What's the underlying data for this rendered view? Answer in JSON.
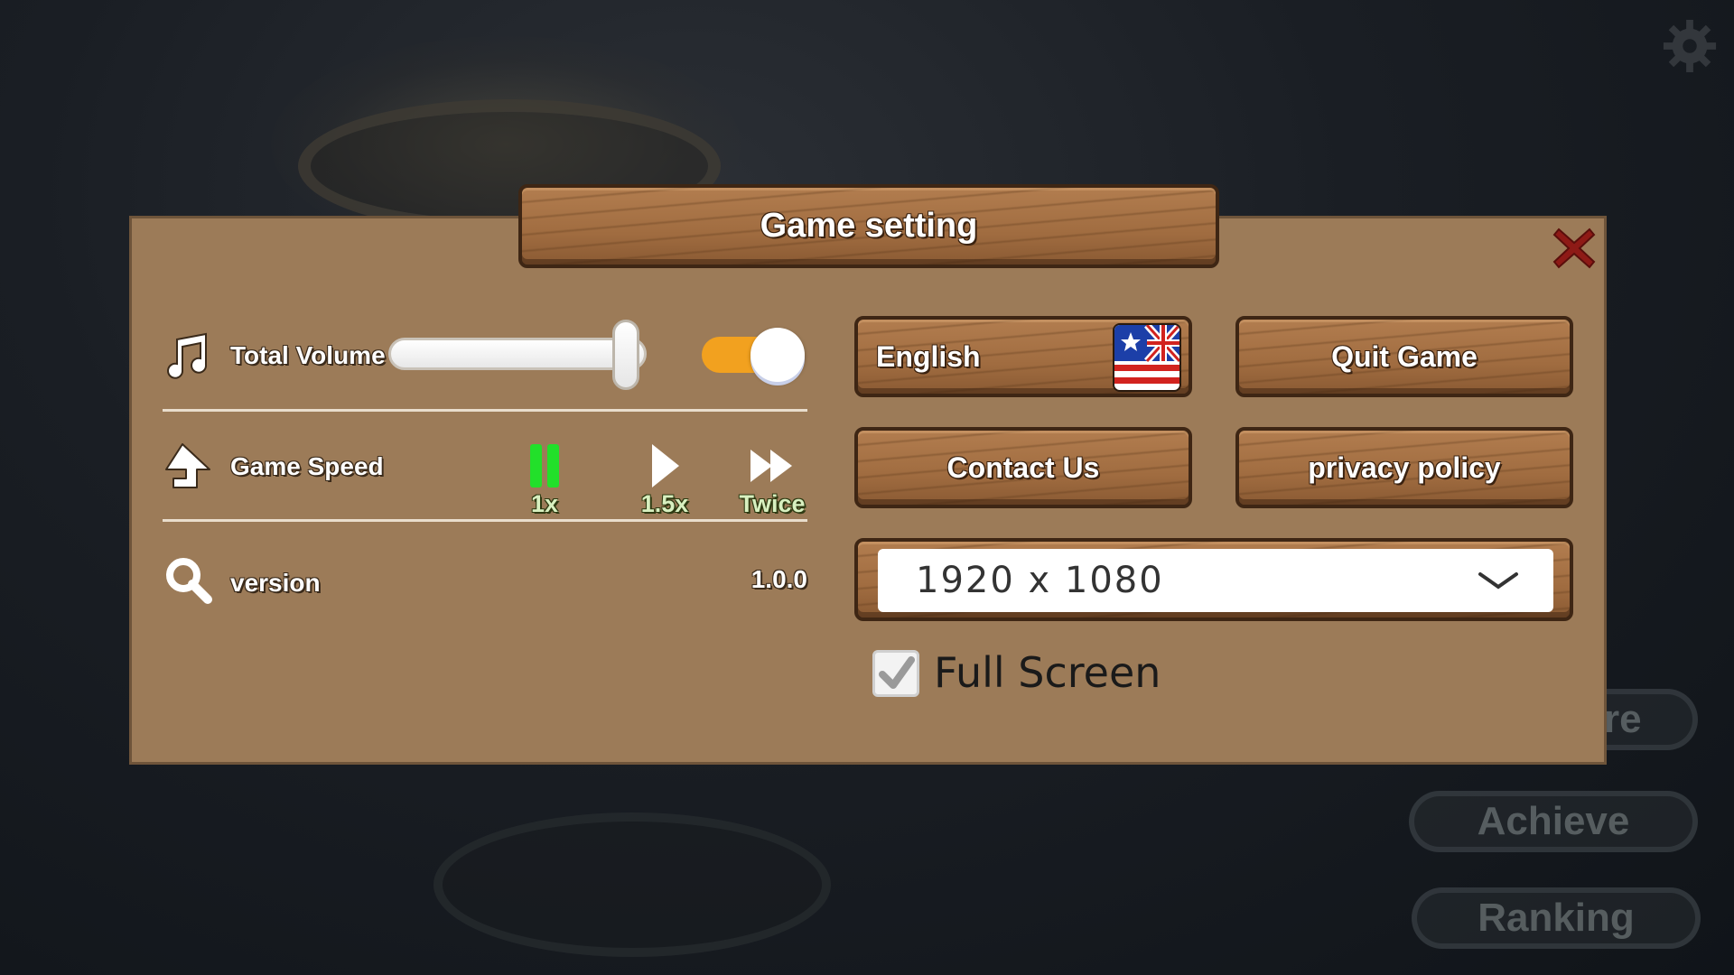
{
  "dialog": {
    "title": "Game setting"
  },
  "settings": {
    "volume": {
      "label": "Total Volume",
      "level": 0.92,
      "enabled": true
    },
    "speed": {
      "label": "Game Speed",
      "options": [
        {
          "label": "1x",
          "icon": "pause-icon",
          "selected": true
        },
        {
          "label": "1.5x",
          "icon": "play-icon",
          "selected": false
        },
        {
          "label": "Twice",
          "icon": "fast-forward-icon",
          "selected": false
        }
      ]
    },
    "version": {
      "label": "version",
      "value": "1.0.0"
    }
  },
  "buttons": {
    "language": "English",
    "quit": "Quit Game",
    "contact": "Contact Us",
    "privacy": "privacy policy"
  },
  "resolution": {
    "value": "1920 x 1080"
  },
  "fullscreen": {
    "label": "Full Screen",
    "checked": true
  },
  "background_menu": {
    "more": "re",
    "achieve": "Achieve",
    "ranking": "Ranking"
  },
  "colors": {
    "panel": "#9c7b58",
    "wood": "#a06c40",
    "toggle_on": "#f2a11f",
    "speed_selected": "#22e02a",
    "close": "#8e1a16"
  }
}
